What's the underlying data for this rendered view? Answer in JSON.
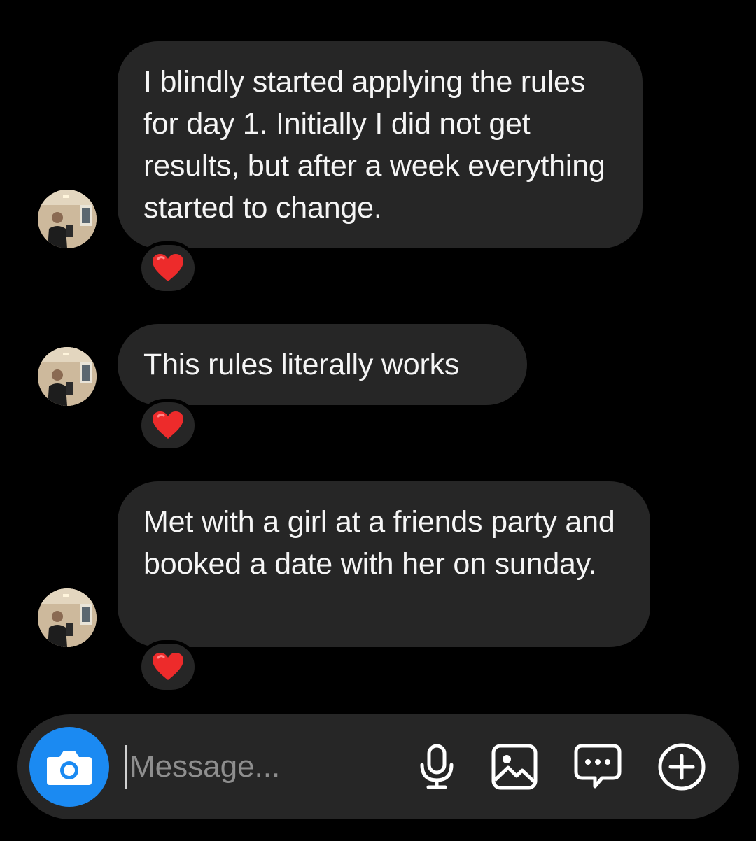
{
  "messages": [
    {
      "text": "I blindly started applying the rules for day 1. Initially I did not get results, but after a week everything started to change.",
      "reaction": "red-heart"
    },
    {
      "text": "This rules literally works",
      "reaction": "red-heart"
    },
    {
      "text": "Met with a girl at a friends party and booked a date with her on sunday.",
      "reaction": "red-heart"
    }
  ],
  "composer": {
    "placeholder": "Message...",
    "camera_icon": "camera-icon",
    "tools": [
      "microphone-icon",
      "gallery-icon",
      "sticker-chat-icon",
      "add-icon"
    ]
  },
  "colors": {
    "background": "#000000",
    "bubble": "#262626",
    "accent_blue": "#1b8af2",
    "heart": "#ed2b2b",
    "placeholder": "#8e8e8e"
  }
}
